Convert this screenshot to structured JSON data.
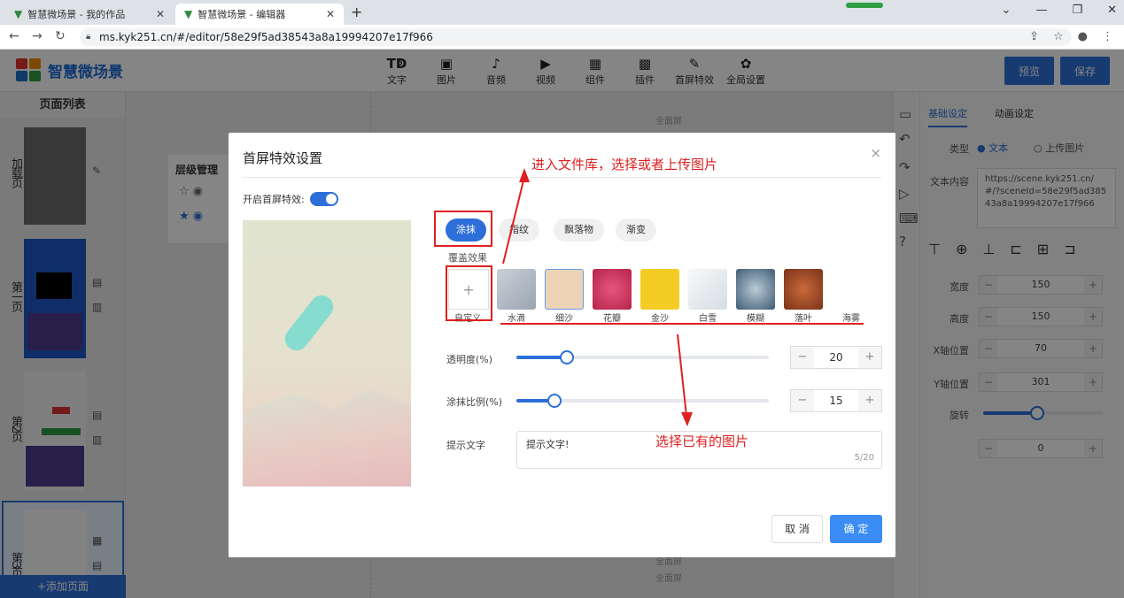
{
  "browser": {
    "tabs": [
      {
        "label": "智慧微场景 - 我的作品"
      },
      {
        "label": "智慧微场景 - 编辑器"
      }
    ],
    "new_tab": "+",
    "url": "ms.kyk251.cn/#/editor/58e29f5ad38543a8a19994207e17f966"
  },
  "app": {
    "logo_text": "智慧微场景",
    "toolbar": [
      {
        "icon": "Tↁ",
        "label": "文字"
      },
      {
        "icon": "▣",
        "label": "图片"
      },
      {
        "icon": "♪",
        "label": "音频"
      },
      {
        "icon": "▶",
        "label": "视频"
      },
      {
        "icon": "▦",
        "label": "组件"
      },
      {
        "icon": "▩",
        "label": "插件"
      },
      {
        "icon": "✎",
        "label": "首屏特效"
      },
      {
        "icon": "✿",
        "label": "全局设置"
      }
    ],
    "preview_btn": "预览",
    "save_btn": "保存"
  },
  "page_list": {
    "title": "页面列表",
    "pages": [
      {
        "label": "加载页"
      },
      {
        "label": "第一页"
      },
      {
        "label": "第2页"
      },
      {
        "label": "第3页"
      }
    ],
    "add_page": "+添加页面"
  },
  "canvas": {
    "full_screen_label": "全面屏"
  },
  "layer_panel": {
    "title": "层级管理"
  },
  "right_panel": {
    "tabs": [
      "基础设定",
      "动画设定"
    ],
    "type_label": "类型",
    "type_options": [
      "文本",
      "上传图片"
    ],
    "text_content_label": "文本内容",
    "text_content_value": "https://scene.kyk251.cn/#/?sceneId=58e29f5ad38543a8a19994207e17f966",
    "fields": [
      {
        "label": "宽度",
        "value": "150"
      },
      {
        "label": "高度",
        "value": "150"
      },
      {
        "label": "X轴位置",
        "value": "70"
      },
      {
        "label": "Y轴位置",
        "value": "301"
      }
    ],
    "rotate_label": "旋转",
    "rotate_value": "0",
    "rotate_fraction": 0.45
  },
  "modal": {
    "title": "首屏特效设置",
    "toggle_label": "开启首屏特效:",
    "effect_types": [
      "涂抹",
      "指纹",
      "飘落物",
      "渐变"
    ],
    "cover_label": "覆盖效果",
    "custom_label": "自定义",
    "custom_icon": "+",
    "swatches": [
      {
        "label": "水滴",
        "color": "#b9c2cc"
      },
      {
        "label": "细沙",
        "color": "#ecd3b5"
      },
      {
        "label": "花瓣",
        "color": "#c8325a"
      },
      {
        "label": "金沙",
        "color": "#f5cc25"
      },
      {
        "label": "白雪",
        "color": "#e8ecef"
      },
      {
        "label": "模糊",
        "color": "#6c8aa3"
      },
      {
        "label": "落叶",
        "color": "#9a4a2a"
      },
      {
        "label": "海雾",
        "color": "#ffffff"
      }
    ],
    "opacity_label": "透明度(%)",
    "opacity_value": "20",
    "opacity_fraction": 0.2,
    "smear_label": "涂抹比例(%)",
    "smear_value": "15",
    "smear_fraction": 0.15,
    "hint_label": "提示文字",
    "hint_value": "提示文字!",
    "hint_count": "5/20",
    "cancel": "取 消",
    "ok": "确 定",
    "close_icon": "×"
  },
  "annotations": {
    "top": "进入文件库，选择或者上传图片",
    "bottom": "选择已有的图片"
  }
}
